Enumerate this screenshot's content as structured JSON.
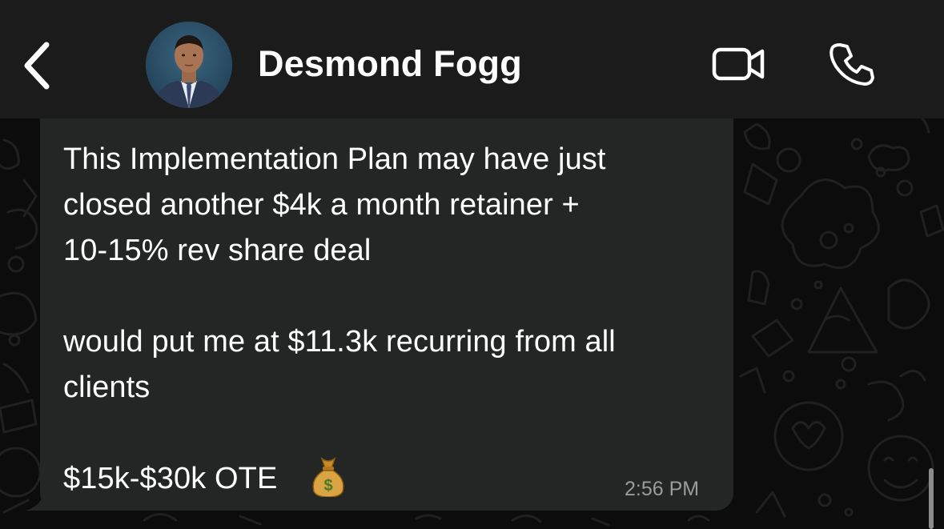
{
  "header": {
    "contact_name": "Desmond Fogg",
    "back_icon": "chevron-left-icon",
    "video_icon": "video-camera-icon",
    "call_icon": "phone-icon",
    "background": "#1b1b1b"
  },
  "message": {
    "lines": [
      "This Implementation Plan may have just",
      "closed another $4k a month retainer +",
      "10-15% rev share deal",
      "",
      "would put me at $11.3k recurring from all",
      "clients",
      "",
      "$15k-$30k OTE"
    ],
    "emoji": "money-bag-icon",
    "time": "2:56 PM",
    "bubble_color": "#242626"
  }
}
